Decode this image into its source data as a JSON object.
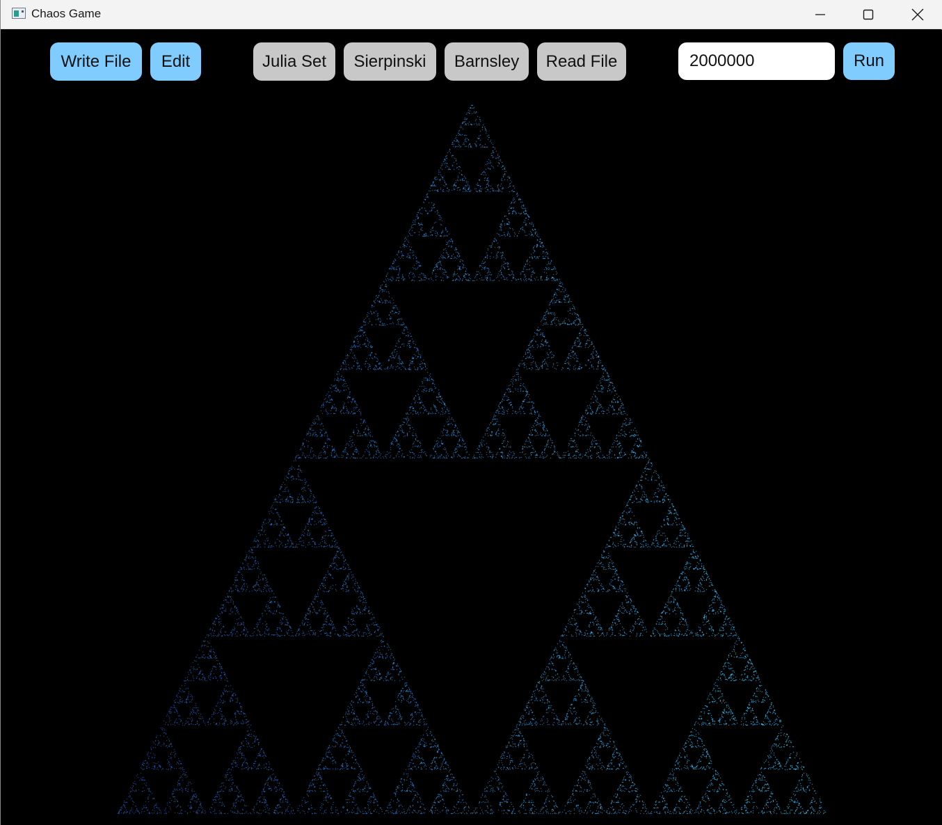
{
  "window": {
    "title": "Chaos Game",
    "app_icon": "window-app-icon",
    "controls": [
      "minimize-icon",
      "maximize-icon",
      "close-icon"
    ]
  },
  "toolbar": {
    "write_file": "Write File",
    "edit": "Edit",
    "julia_set": "Julia Set",
    "sierpinski": "Sierpinski",
    "barnsley": "Barnsley",
    "read_file": "Read File",
    "iterations_value": "2000000",
    "run": "Run"
  },
  "colors": {
    "canvas_background": "#000000",
    "blue_button": "#80ccff",
    "gray_button": "#c8c8c8",
    "fractal_dark": "#1a2a9c",
    "fractal_light": "#4fd2ff"
  },
  "canvas": {
    "fractal": "Sierpinski triangle",
    "rendering": "chaos game point cloud"
  }
}
